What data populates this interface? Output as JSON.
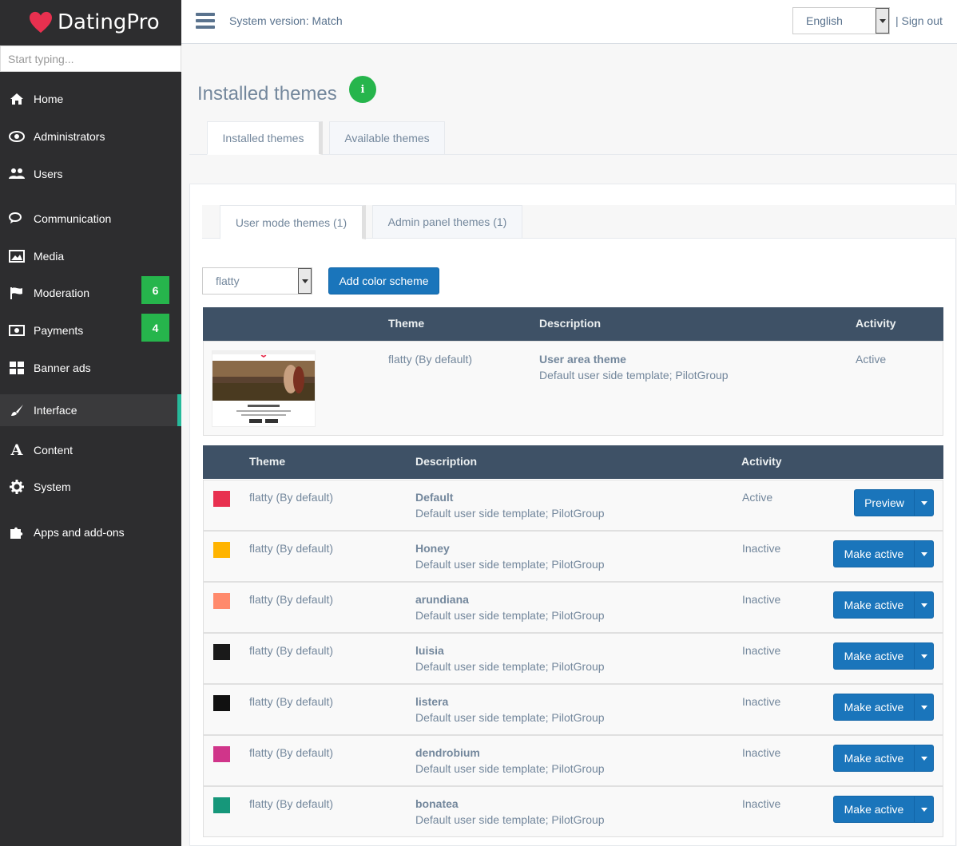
{
  "brand": {
    "name": "DatingPro"
  },
  "search": {
    "placeholder": "Start typing..."
  },
  "sidebar": {
    "items": [
      {
        "label": "Home",
        "icon": "home-icon"
      },
      {
        "label": "Administrators",
        "icon": "eye-icon"
      },
      {
        "label": "Users",
        "icon": "users-icon"
      },
      {
        "label": "Communication",
        "icon": "chat-icon"
      },
      {
        "label": "Media",
        "icon": "image-icon"
      },
      {
        "label": "Moderation",
        "icon": "flag-icon",
        "badge": "6"
      },
      {
        "label": "Payments",
        "icon": "money-icon",
        "badge": "4"
      },
      {
        "label": "Banner ads",
        "icon": "grid-icon"
      },
      {
        "label": "Interface",
        "icon": "brush-icon",
        "active": true
      },
      {
        "label": "Content",
        "icon": "font-icon"
      },
      {
        "label": "System",
        "icon": "gear-icon"
      },
      {
        "label": "Apps and add-ons",
        "icon": "puzzle-icon"
      }
    ]
  },
  "header": {
    "system_version": "System version: Match",
    "language": "English",
    "signout": "| Sign out"
  },
  "main": {
    "title": "Installed themes",
    "info": "i",
    "tabs": [
      "Installed themes",
      "Available themes"
    ],
    "subtabs": [
      "User mode themes (1)",
      "Admin panel themes (1)"
    ],
    "scheme_select": "flatty",
    "add_scheme": "Add color scheme"
  },
  "themes_table": {
    "headers": [
      "Theme",
      "Description",
      "Activity"
    ],
    "row": {
      "theme": "flatty  (By default)",
      "desc_title": "User area theme",
      "desc": "Default user side template; PilotGroup",
      "activity": "Active"
    }
  },
  "schemes_table": {
    "headers": [
      "Theme",
      "Description",
      "Activity"
    ],
    "rows": [
      {
        "color": "#e8304f",
        "theme": "flatty  (By default)",
        "name": "Default",
        "desc": "Default user side template; PilotGroup",
        "activity": "Active",
        "action": "Preview"
      },
      {
        "color": "#ffb400",
        "theme": "flatty  (By default)",
        "name": "Honey",
        "desc": "Default user side template; PilotGroup",
        "activity": "Inactive",
        "action": "Make active"
      },
      {
        "color": "#ff8a6c",
        "theme": "flatty  (By default)",
        "name": "arundiana",
        "desc": "Default user side template; PilotGroup",
        "activity": "Inactive",
        "action": "Make active"
      },
      {
        "color": "#1a1a1a",
        "theme": "flatty  (By default)",
        "name": "luisia",
        "desc": "Default user side template; PilotGroup",
        "activity": "Inactive",
        "action": "Make active"
      },
      {
        "color": "#111111",
        "theme": "flatty  (By default)",
        "name": "listera",
        "desc": "Default user side template; PilotGroup",
        "activity": "Inactive",
        "action": "Make active"
      },
      {
        "color": "#d0358a",
        "theme": "flatty  (By default)",
        "name": "dendrobium",
        "desc": "Default user side template; PilotGroup",
        "activity": "Inactive",
        "action": "Make active"
      },
      {
        "color": "#16977a",
        "theme": "flatty  (By default)",
        "name": "bonatea",
        "desc": "Default user side template; PilotGroup",
        "activity": "Inactive",
        "action": "Make active"
      }
    ]
  }
}
